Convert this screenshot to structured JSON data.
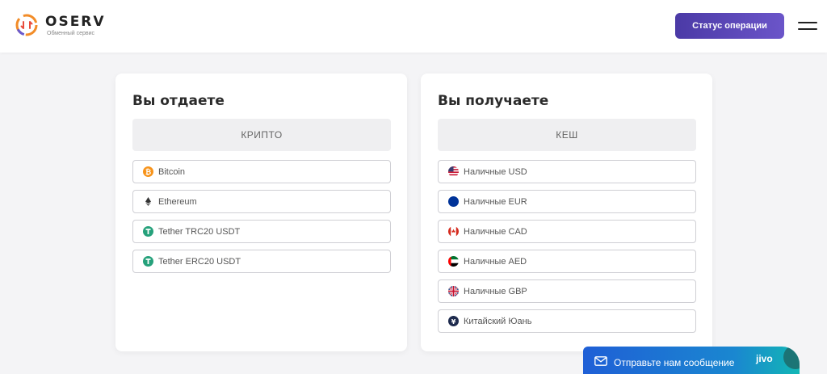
{
  "header": {
    "logo_name": "OSERV",
    "logo_sub": "Обменный сервис",
    "status_button": "Статус операции"
  },
  "give": {
    "title": "Вы отдаете",
    "tab": "КРИПТО",
    "items": [
      {
        "label": "Bitcoin",
        "icon": "bitcoin-icon"
      },
      {
        "label": "Ethereum",
        "icon": "ethereum-icon"
      },
      {
        "label": "Tether TRC20 USDT",
        "icon": "tether-icon"
      },
      {
        "label": "Tether ERC20 USDT",
        "icon": "tether-icon"
      }
    ]
  },
  "receive": {
    "title": "Вы получаете",
    "tab": "КЕШ",
    "items": [
      {
        "label": "Наличные USD",
        "icon": "usa-flag-icon"
      },
      {
        "label": "Наличные EUR",
        "icon": "eu-flag-icon"
      },
      {
        "label": "Наличные CAD",
        "icon": "canada-flag-icon"
      },
      {
        "label": "Наличные AED",
        "icon": "uae-flag-icon"
      },
      {
        "label": "Наличные GBP",
        "icon": "uk-flag-icon"
      },
      {
        "label": "Китайский Юань",
        "icon": "yuan-icon"
      }
    ]
  },
  "chat": {
    "label": "Отправьте нам сообщение",
    "brand": "jivo"
  },
  "colors": {
    "accent": "#5a46b8",
    "bitcoin": "#f7931a",
    "tether": "#26a17b",
    "chat": "#1f5fd6"
  }
}
